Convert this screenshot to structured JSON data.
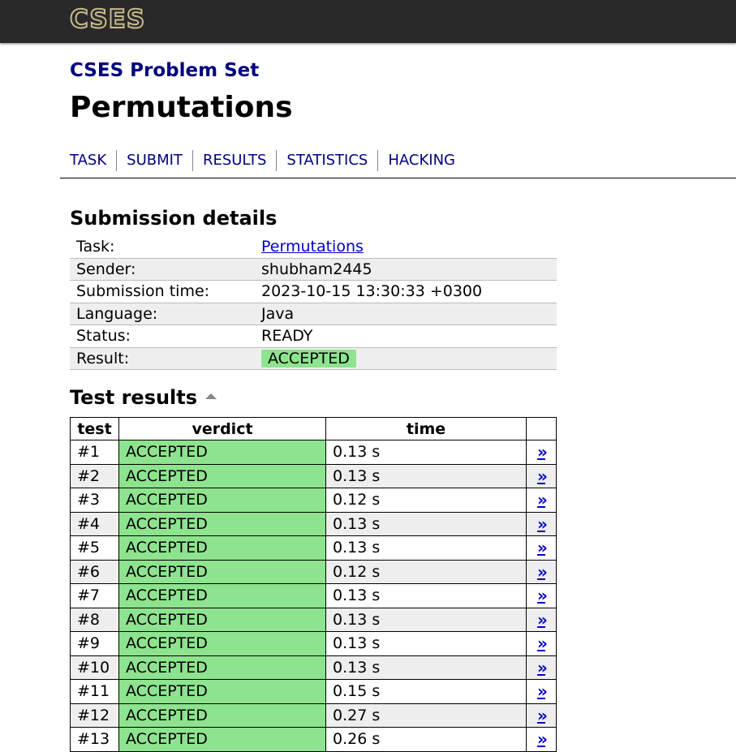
{
  "header": {
    "logo": "CSES"
  },
  "site_title": "CSES Problem Set",
  "page_title": "Permutations",
  "nav": [
    "TASK",
    "SUBMIT",
    "RESULTS",
    "STATISTICS",
    "HACKING"
  ],
  "submission": {
    "heading": "Submission details",
    "rows": [
      {
        "label": "Task:",
        "value": "Permutations"
      },
      {
        "label": "Sender:",
        "value": "shubham2445"
      },
      {
        "label": "Submission time:",
        "value": "2023-10-15 13:30:33 +0300"
      },
      {
        "label": "Language:",
        "value": "Java"
      },
      {
        "label": "Status:",
        "value": "READY"
      },
      {
        "label": "Result:",
        "value": "ACCEPTED"
      }
    ]
  },
  "tests": {
    "heading": "Test results",
    "columns": [
      "test",
      "verdict",
      "time",
      ""
    ],
    "link_glyph": "»",
    "rows": [
      {
        "test": "#1",
        "verdict": "ACCEPTED",
        "time": "0.13 s"
      },
      {
        "test": "#2",
        "verdict": "ACCEPTED",
        "time": "0.13 s"
      },
      {
        "test": "#3",
        "verdict": "ACCEPTED",
        "time": "0.12 s"
      },
      {
        "test": "#4",
        "verdict": "ACCEPTED",
        "time": "0.13 s"
      },
      {
        "test": "#5",
        "verdict": "ACCEPTED",
        "time": "0.13 s"
      },
      {
        "test": "#6",
        "verdict": "ACCEPTED",
        "time": "0.12 s"
      },
      {
        "test": "#7",
        "verdict": "ACCEPTED",
        "time": "0.13 s"
      },
      {
        "test": "#8",
        "verdict": "ACCEPTED",
        "time": "0.13 s"
      },
      {
        "test": "#9",
        "verdict": "ACCEPTED",
        "time": "0.13 s"
      },
      {
        "test": "#10",
        "verdict": "ACCEPTED",
        "time": "0.13 s"
      },
      {
        "test": "#11",
        "verdict": "ACCEPTED",
        "time": "0.15 s"
      },
      {
        "test": "#12",
        "verdict": "ACCEPTED",
        "time": "0.27 s"
      },
      {
        "test": "#13",
        "verdict": "ACCEPTED",
        "time": "0.26 s"
      }
    ]
  },
  "colors": {
    "topbar": "#292929",
    "title_blue": "#000080",
    "link_blue": "#0000cc",
    "accepted_green": "#8ee38e",
    "row_alt": "#eeeeee"
  }
}
